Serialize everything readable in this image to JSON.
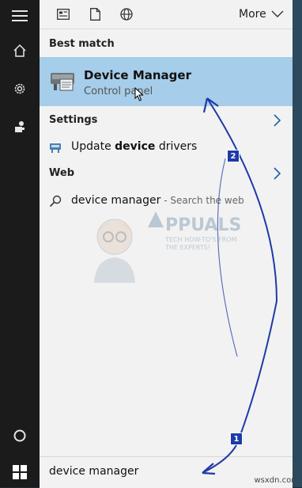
{
  "topbar": {
    "more_label": "More",
    "icons": [
      "document-grid-icon",
      "page-icon",
      "globe-icon"
    ]
  },
  "sections": {
    "best_match": "Best match",
    "settings": "Settings",
    "web": "Web"
  },
  "best_match": {
    "title": "Device Manager",
    "subtitle": "Control panel"
  },
  "settings_item": {
    "pre": "Update ",
    "bold": "device",
    "post": " drivers"
  },
  "web_item": {
    "query": "device manager",
    "suffix": " - Search the web"
  },
  "search": {
    "value": "device manager"
  },
  "watermark": {
    "brand": "PPUALS",
    "line1": "TECH HOW-TO'S FROM",
    "line2": "THE EXPERTS!"
  },
  "annotations": [
    "1",
    "2"
  ],
  "credit": "wsxdn.com",
  "colors": {
    "rail": "#1b1b1b",
    "panel": "#f2f2f2",
    "highlight": "#a6cde9",
    "accent": "#1e5fa8",
    "annotation": "#1e3aa8"
  }
}
